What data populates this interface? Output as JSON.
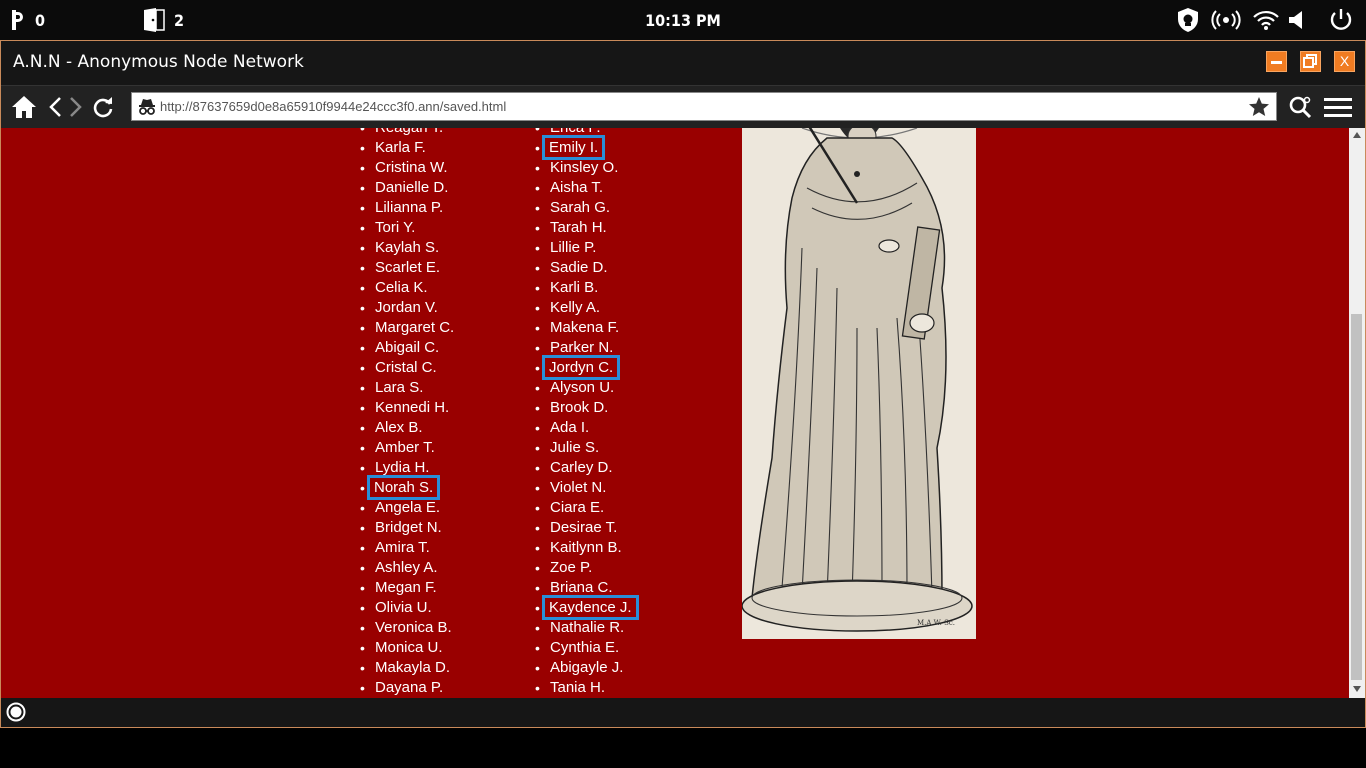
{
  "system": {
    "coin_count": "0",
    "doors_count": "2",
    "clock": "10:13 PM"
  },
  "window": {
    "title": "A.N.N - Anonymous Node Network",
    "minimize": "–",
    "maximize": "❐",
    "close": "X"
  },
  "browser": {
    "url": "http://87637659d0e8a65910f9944e24ccc3f0.ann/saved.html"
  },
  "column1": [
    {
      "name": "Reagan T."
    },
    {
      "name": "Karla F."
    },
    {
      "name": "Cristina W."
    },
    {
      "name": "Danielle D."
    },
    {
      "name": "Lilianna P."
    },
    {
      "name": "Tori Y."
    },
    {
      "name": "Kaylah S."
    },
    {
      "name": "Scarlet E."
    },
    {
      "name": "Celia K."
    },
    {
      "name": "Jordan V."
    },
    {
      "name": "Margaret C."
    },
    {
      "name": "Abigail C."
    },
    {
      "name": "Cristal C."
    },
    {
      "name": "Lara S."
    },
    {
      "name": "Kennedi H."
    },
    {
      "name": "Alex B."
    },
    {
      "name": "Amber T."
    },
    {
      "name": "Lydia H."
    },
    {
      "name": "Norah S.",
      "highlighted": true
    },
    {
      "name": "Angela E."
    },
    {
      "name": "Bridget N."
    },
    {
      "name": "Amira T."
    },
    {
      "name": "Ashley A."
    },
    {
      "name": "Megan F."
    },
    {
      "name": "Olivia U."
    },
    {
      "name": "Veronica B."
    },
    {
      "name": "Monica U."
    },
    {
      "name": "Makayla D."
    },
    {
      "name": " Dayana P."
    }
  ],
  "column2": [
    {
      "name": "Erica P."
    },
    {
      "name": "Emily I.",
      "highlighted": true
    },
    {
      "name": "Kinsley O."
    },
    {
      "name": "Aisha T."
    },
    {
      "name": "Sarah G."
    },
    {
      "name": "Tarah H."
    },
    {
      "name": "Lillie P."
    },
    {
      "name": "Sadie D."
    },
    {
      "name": "Karli B."
    },
    {
      "name": "Kelly A."
    },
    {
      "name": "Makena F."
    },
    {
      "name": "Parker N."
    },
    {
      "name": "Jordyn C.",
      "highlighted": true
    },
    {
      "name": "Alyson U."
    },
    {
      "name": "Brook D."
    },
    {
      "name": "Ada I."
    },
    {
      "name": "Julie S."
    },
    {
      "name": "Carley D."
    },
    {
      "name": "Violet N."
    },
    {
      "name": "Ciara E."
    },
    {
      "name": "Desirae T."
    },
    {
      "name": "Kaitlynn B."
    },
    {
      "name": "Zoe P."
    },
    {
      "name": "Briana C."
    },
    {
      "name": "Kaydence J.",
      "highlighted": true
    },
    {
      "name": "Nathalie R."
    },
    {
      "name": "Cynthia E."
    },
    {
      "name": "Abigayle J."
    },
    {
      "name": "Tania H."
    }
  ],
  "colors": {
    "page_background": "#990000",
    "highlight_box": "#2a8ed8",
    "window_button": "#f07c22"
  },
  "statue_signature": "M.A.W. Sc."
}
